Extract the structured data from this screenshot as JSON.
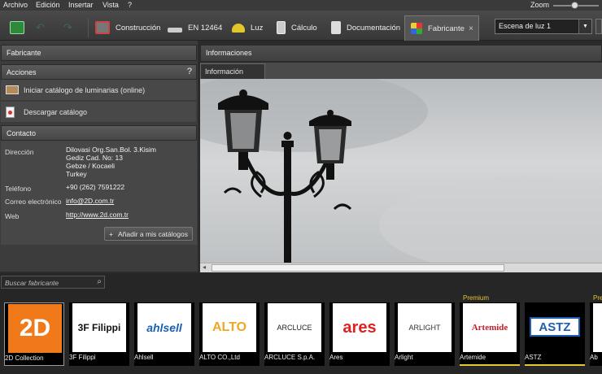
{
  "menu": {
    "archivo": "Archivo",
    "edicion": "Edición",
    "insertar": "Insertar",
    "vista": "Vista",
    "help": "?",
    "zoom": "Zoom"
  },
  "toolbar": {
    "construccion": "Construcción",
    "en": "EN 12464",
    "luz": "Luz",
    "calculo": "Cálculo",
    "documentacion": "Documentación",
    "fabricante": "Fabricante",
    "close": "×",
    "scene": "Escena de luz 1"
  },
  "left": {
    "fabricante_header": "Fabricante",
    "acciones_header": "Acciones",
    "acciones_help": "?",
    "action1": "Iniciar catálogo de luminarias (online)",
    "action2": "Descargar catálogo",
    "contacto_header": "Contacto",
    "direccion_label": "Dirección",
    "direccion_lines": [
      "Dilovasi Org.San.Bol. 3.Kisim",
      "Gediz Cad. No: 13",
      "Gebze / Kocaeli",
      "Turkey"
    ],
    "telefono_label": "Teléfono",
    "telefono": "+90 (262) 7591222",
    "correo_label": "Correo electrónico",
    "correo": "info@2D.com.tr",
    "web_label": "Web",
    "web": "http://www.2d.com.tr",
    "add_button": "Añadir a mis catálogos"
  },
  "right": {
    "info_header": "Informaciones",
    "info_tab": "Información"
  },
  "bottom": {
    "search_placeholder": "Buscar fabricante",
    "premium": "Premium",
    "manufacturers": [
      {
        "name": "2D Collection",
        "logo": "2D"
      },
      {
        "name": "3F Filippi",
        "logo": "3F Filippi"
      },
      {
        "name": "Ahlsell",
        "logo": "ahlsell"
      },
      {
        "name": "ALTO CO.,Ltd",
        "logo": "ALTO"
      },
      {
        "name": "ARCLUCE S.p.A.",
        "logo": "ARCLUCE"
      },
      {
        "name": "Ares",
        "logo": "ares"
      },
      {
        "name": "Arlight",
        "logo": "ARLIGHT"
      },
      {
        "name": "Artemide",
        "logo": "Artemide"
      },
      {
        "name": "ASTZ",
        "logo": "ASTZ"
      },
      {
        "name": "Ab",
        "logo": ""
      }
    ]
  }
}
